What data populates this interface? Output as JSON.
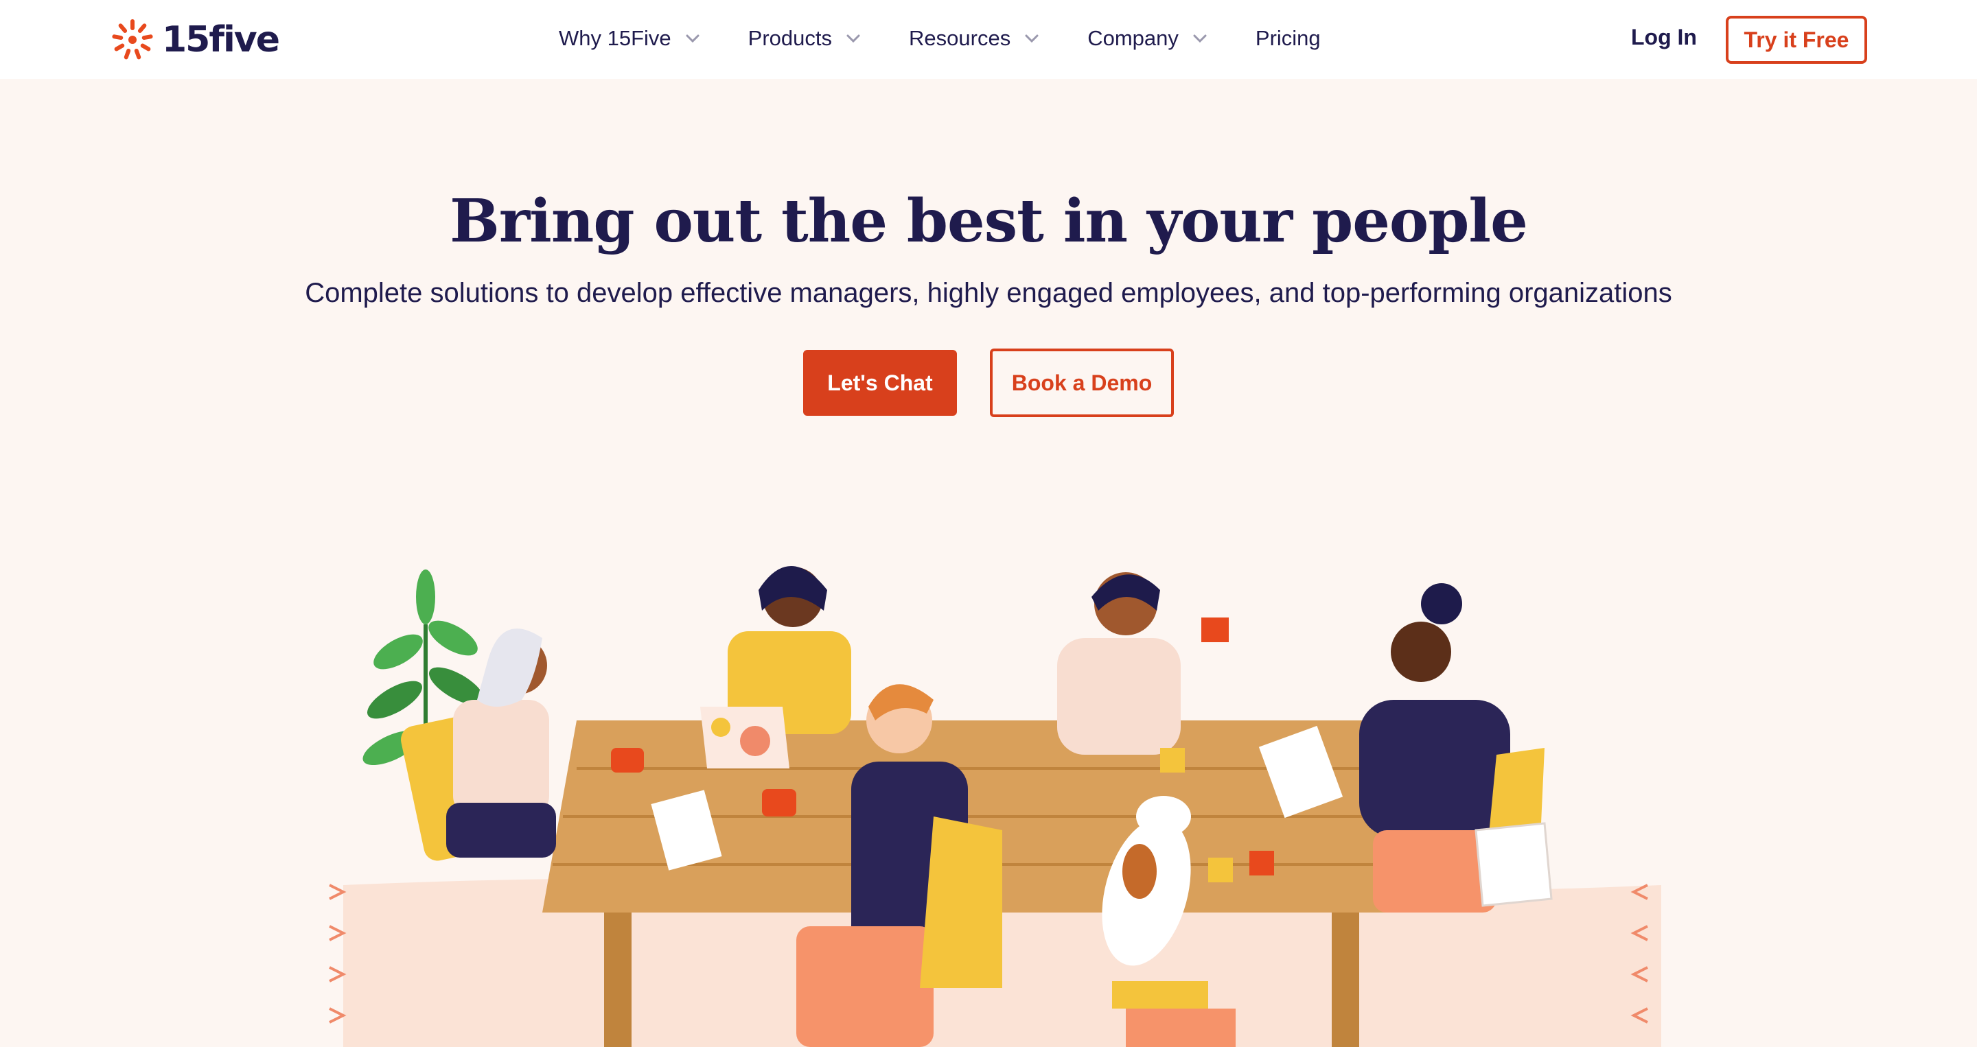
{
  "brand": {
    "name": "15five",
    "accent": "#d8401c",
    "navy": "#1f1b4d"
  },
  "nav": {
    "items": [
      {
        "label": "Why 15Five",
        "dropdown": true
      },
      {
        "label": "Products",
        "dropdown": true
      },
      {
        "label": "Resources",
        "dropdown": true
      },
      {
        "label": "Company",
        "dropdown": true
      },
      {
        "label": "Pricing",
        "dropdown": false
      }
    ],
    "login_label": "Log In",
    "try_label": "Try it Free"
  },
  "hero": {
    "title": "Bring out the best in your people",
    "subtitle": "Complete solutions to develop effective managers, highly engaged employees, and top-performing organizations",
    "primary_cta": "Let's Chat",
    "secondary_cta": "Book a Demo"
  },
  "icons": [
    "logo-mark-icon",
    "chevron-down-icon"
  ]
}
